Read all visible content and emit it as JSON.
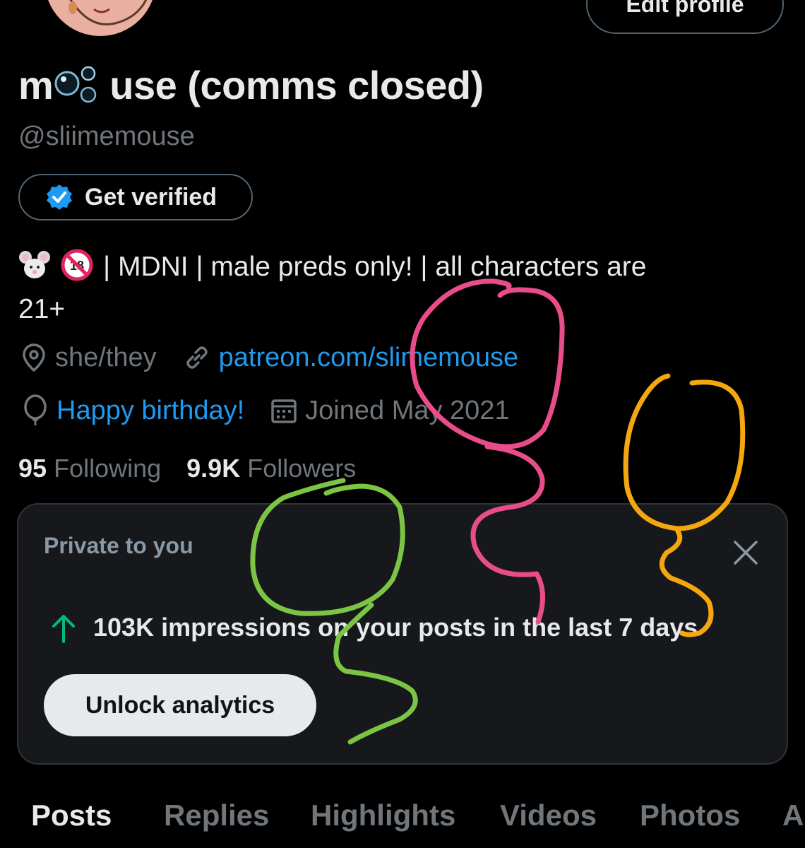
{
  "profile": {
    "edit_label": "Edit profile",
    "name_prefix": "m",
    "name_suffix": "use (comms closed)",
    "handle": "@sliimemouse",
    "verify_label": "Get verified",
    "bio_line1": "| MDNI | male preds only! | all characters are",
    "bio_line2": "21+",
    "pronouns": "she/they",
    "link": "patreon.com/slimemouse",
    "birthday": "Happy birthday!",
    "joined": "Joined May 2021",
    "following_count": "95",
    "following_label": "Following",
    "followers_count": "9.9K",
    "followers_label": "Followers"
  },
  "private_card": {
    "title": "Private to you",
    "impressions": "103K impressions on your posts in the last 7 days",
    "unlock_label": "Unlock analytics"
  },
  "tabs": [
    {
      "label": "Posts",
      "active": true
    },
    {
      "label": "Replies",
      "active": false
    },
    {
      "label": "Highlights",
      "active": false
    },
    {
      "label": "Videos",
      "active": false
    },
    {
      "label": "Photos",
      "active": false
    },
    {
      "label": "A",
      "active": false
    }
  ],
  "colors": {
    "link": "#1d9bf0",
    "muted": "#71767b",
    "scribble_pink": "#e84d8a",
    "scribble_orange": "#f5a70f",
    "scribble_green": "#7cc444"
  },
  "icons": [
    "location-icon",
    "link-icon",
    "balloon-icon",
    "calendar-icon",
    "verified-badge-icon",
    "close-icon",
    "arrow-up-icon"
  ]
}
